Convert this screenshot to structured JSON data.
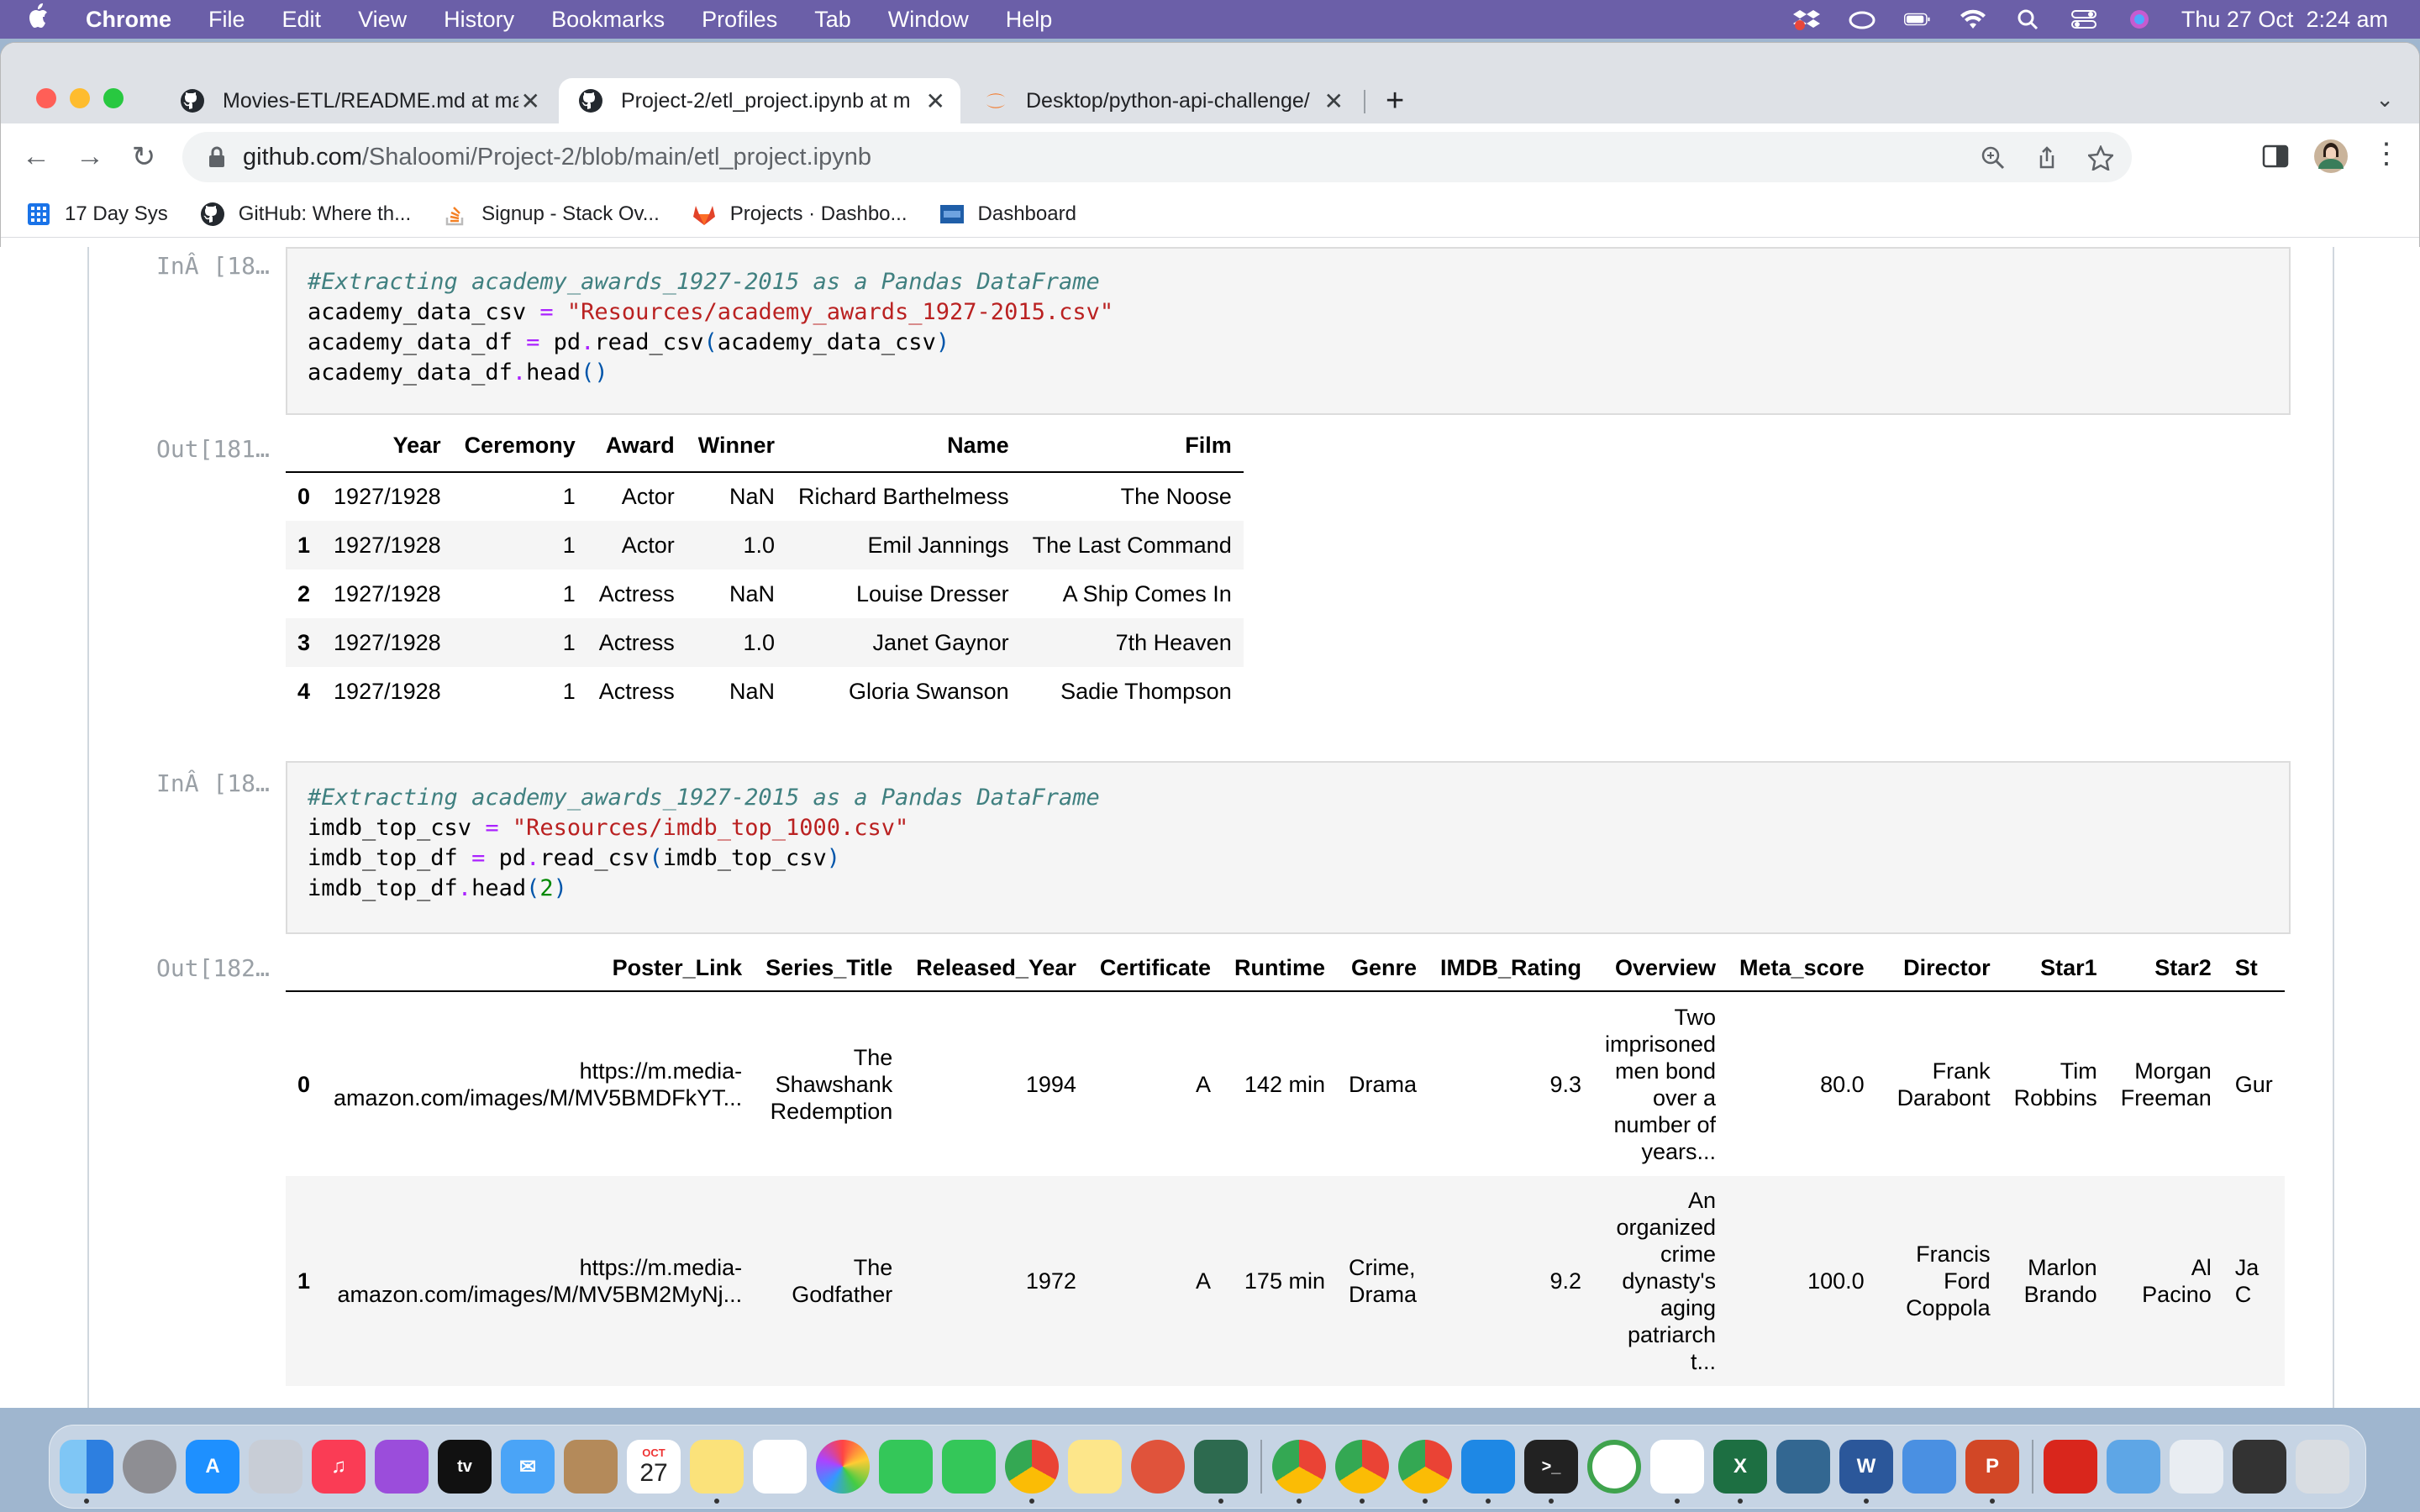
{
  "menubar": {
    "app": "Chrome",
    "menus": [
      "File",
      "Edit",
      "View",
      "History",
      "Bookmarks",
      "Profiles",
      "Tab",
      "Window",
      "Help"
    ],
    "clock": "Thu 27 Oct  2:24 am"
  },
  "tabs": [
    {
      "title": "Movies-ETL/README.md at ma",
      "icon": "github-icon",
      "active": false
    },
    {
      "title": "Project-2/etl_project.ipynb at m",
      "icon": "github-icon",
      "active": true
    },
    {
      "title": "Desktop/python-api-challenge/",
      "icon": "jupyter-icon",
      "active": false
    }
  ],
  "address_bar": {
    "domain": "github.com",
    "path": "/Shaloomi/Project-2/blob/main/etl_project.ipynb"
  },
  "bookmarks": [
    {
      "label": "17 Day Sys",
      "icon": "grid-icon"
    },
    {
      "label": "GitHub: Where th...",
      "icon": "github-icon"
    },
    {
      "label": "Signup - Stack Ov...",
      "icon": "stackoverflow-icon"
    },
    {
      "label": "Projects · Dashbo...",
      "icon": "gitlab-icon"
    },
    {
      "label": "Dashboard",
      "icon": "dashboard-icon"
    }
  ],
  "cells": [
    {
      "in_prompt": "InÂ [18…",
      "code": {
        "comment": "#Extracting academy_awards_1927-2015 as a Pandas DataFrame",
        "l2_var": "academy_data_csv",
        "l2_str": "\"Resources/academy_awards_1927-2015.csv\"",
        "l3_var": "academy_data_df",
        "l3_call": "pd",
        "l3_fn": "read_csv",
        "l3_arg": "academy_data_csv",
        "l4_var": "academy_data_df",
        "l4_fn": "head"
      },
      "out_prompt": "Out[181…",
      "table": {
        "columns": [
          "Year",
          "Ceremony",
          "Award",
          "Winner",
          "Name",
          "Film"
        ],
        "rows": [
          {
            "index": "0",
            "values": [
              "1927/1928",
              "1",
              "Actor",
              "NaN",
              "Richard Barthelmess",
              "The Noose"
            ]
          },
          {
            "index": "1",
            "values": [
              "1927/1928",
              "1",
              "Actor",
              "1.0",
              "Emil Jannings",
              "The Last Command"
            ]
          },
          {
            "index": "2",
            "values": [
              "1927/1928",
              "1",
              "Actress",
              "NaN",
              "Louise Dresser",
              "A Ship Comes In"
            ]
          },
          {
            "index": "3",
            "values": [
              "1927/1928",
              "1",
              "Actress",
              "1.0",
              "Janet Gaynor",
              "7th Heaven"
            ]
          },
          {
            "index": "4",
            "values": [
              "1927/1928",
              "1",
              "Actress",
              "NaN",
              "Gloria Swanson",
              "Sadie Thompson"
            ]
          }
        ]
      }
    },
    {
      "in_prompt": "InÂ [18…",
      "code": {
        "comment": "#Extracting academy_awards_1927-2015 as a Pandas DataFrame",
        "l2_var": "imdb_top_csv",
        "l2_str": "\"Resources/imdb_top_1000.csv\"",
        "l3_var": "imdb_top_df",
        "l3_call": "pd",
        "l3_fn": "read_csv",
        "l3_arg": "imdb_top_csv",
        "l4_var": "imdb_top_df",
        "l4_fn": "head",
        "l4_arg": "2"
      },
      "out_prompt": "Out[182…",
      "table": {
        "columns": [
          "Poster_Link",
          "Series_Title",
          "Released_Year",
          "Certificate",
          "Runtime",
          "Genre",
          "IMDB_Rating",
          "Overview",
          "Meta_score",
          "Director",
          "Star1",
          "Star2",
          "St"
        ],
        "rows": [
          {
            "index": "0",
            "values": [
              "https://m.media-amazon.com/images/M/MV5BMDFkYT...",
              "The Shawshank Redemption",
              "1994",
              "A",
              "142 min",
              "Drama",
              "9.3",
              "Two imprisoned men bond over a number of years...",
              "80.0",
              "Frank Darabont",
              "Tim Robbins",
              "Morgan Freeman",
              "Gur"
            ]
          },
          {
            "index": "1",
            "values": [
              "https://m.media-amazon.com/images/M/MV5BM2MyNj...",
              "The Godfather",
              "1972",
              "A",
              "175 min",
              "Crime, Drama",
              "9.2",
              "An organized crime dynasty's aging patriarch t...",
              "100.0",
              "Francis Ford Coppola",
              "Marlon Brando",
              "Al Pacino",
              "Ja C"
            ]
          }
        ]
      }
    }
  ],
  "dock": {
    "calendar_month": "OCT",
    "calendar_day": "27",
    "apps": [
      "finder",
      "system-settings",
      "app-store",
      "launchpad",
      "music",
      "podcasts",
      "tv",
      "mail",
      "contacts",
      "calendar",
      "notes",
      "reminders",
      "photos",
      "messages",
      "facetime",
      "chrome",
      "stickies",
      "git-client",
      "wifi-tool",
      "chrome-2",
      "chrome-3",
      "chrome-4",
      "vscode",
      "terminal",
      "activity",
      "slack",
      "excel",
      "postgres",
      "word",
      "xcode-tools",
      "powerpoint",
      "acrobat",
      "folder",
      "preview",
      "window-grid",
      "trash"
    ]
  },
  "colors": {
    "menubar": "#6b5fa8",
    "code_comment": "#408080",
    "code_string": "#ba2121",
    "code_operator": "#aa22ff"
  }
}
